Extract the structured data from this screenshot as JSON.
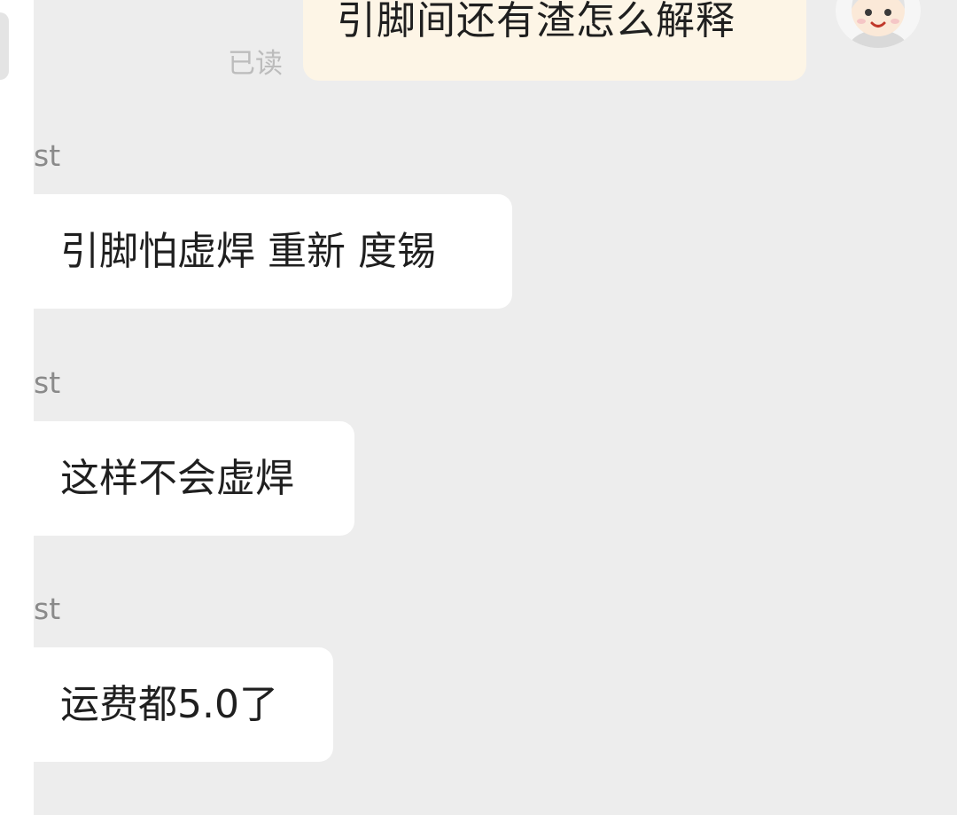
{
  "colors": {
    "chat_background": "#ededed",
    "outgoing_bubble": "#fdf5e6",
    "incoming_bubble": "#ffffff",
    "read_status_text": "#bcbcbc",
    "sender_name_text": "#8a8a8a",
    "message_text": "#1f1f1f"
  },
  "outgoing_message": {
    "text": "引脚间还有渣怎么解释",
    "read_status": "已读",
    "avatar_icon": "cartoon-face-avatar-icon"
  },
  "incoming_messages": [
    {
      "sender": "st",
      "text": "引脚怕虚焊 重新 度锡"
    },
    {
      "sender": "st",
      "text": "这样不会虚焊"
    },
    {
      "sender": "st",
      "text": "运费都5.0了"
    }
  ]
}
